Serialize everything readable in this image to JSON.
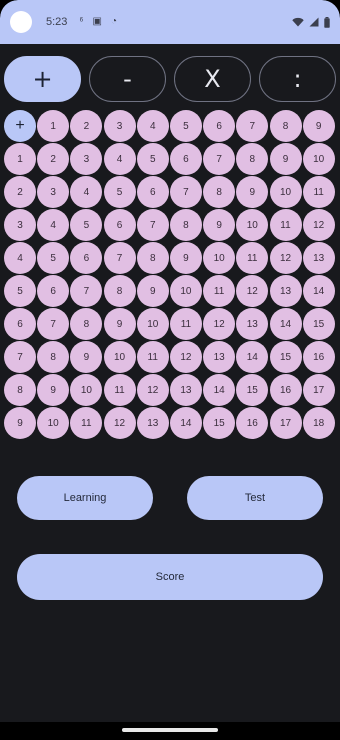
{
  "status_bar": {
    "time": "5:23",
    "icons": [
      "notification-icon",
      "storage-icon",
      "sync-icon",
      "wifi-icon",
      "signal-icon",
      "battery-icon"
    ],
    "notification_glyph": "⁶",
    "storage_glyph": "▣",
    "sync_glyph": "◔"
  },
  "operations": [
    {
      "label": "+",
      "active": true
    },
    {
      "label": "-",
      "active": false
    },
    {
      "label": "X",
      "active": false
    },
    {
      "label": ":",
      "active": false
    }
  ],
  "table": {
    "corner_label": "+",
    "header": [
      "1",
      "2",
      "3",
      "4",
      "5",
      "6",
      "7",
      "8",
      "9"
    ],
    "rows": [
      {
        "label": "1",
        "values": [
          "2",
          "3",
          "4",
          "5",
          "6",
          "7",
          "8",
          "9",
          "10"
        ]
      },
      {
        "label": "2",
        "values": [
          "3",
          "4",
          "5",
          "6",
          "7",
          "8",
          "9",
          "10",
          "11"
        ]
      },
      {
        "label": "3",
        "values": [
          "4",
          "5",
          "6",
          "7",
          "8",
          "9",
          "10",
          "11",
          "12"
        ]
      },
      {
        "label": "4",
        "values": [
          "5",
          "6",
          "7",
          "8",
          "9",
          "10",
          "11",
          "12",
          "13"
        ]
      },
      {
        "label": "5",
        "values": [
          "6",
          "7",
          "8",
          "9",
          "10",
          "11",
          "12",
          "13",
          "14"
        ]
      },
      {
        "label": "6",
        "values": [
          "7",
          "8",
          "9",
          "10",
          "11",
          "12",
          "13",
          "14",
          "15"
        ]
      },
      {
        "label": "7",
        "values": [
          "8",
          "9",
          "10",
          "11",
          "12",
          "13",
          "14",
          "15",
          "16"
        ]
      },
      {
        "label": "8",
        "values": [
          "9",
          "10",
          "11",
          "12",
          "13",
          "14",
          "15",
          "16",
          "17"
        ]
      },
      {
        "label": "9",
        "values": [
          "10",
          "11",
          "12",
          "13",
          "14",
          "15",
          "16",
          "17",
          "18"
        ]
      }
    ]
  },
  "buttons": {
    "learning": "Learning",
    "test": "Test",
    "score": "Score"
  },
  "colors": {
    "accent": "#b9c7f7",
    "cell": "#e1bfe3",
    "background": "#18191d",
    "outline": "#6f7282"
  }
}
